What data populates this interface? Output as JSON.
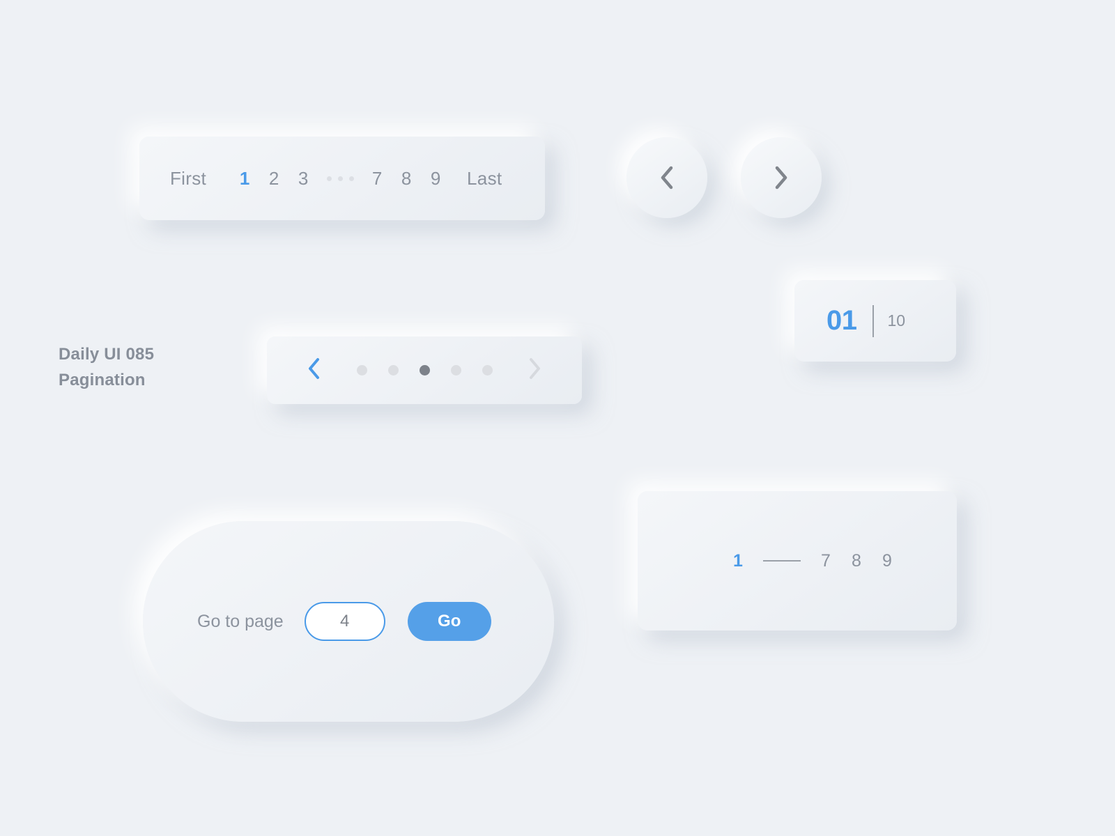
{
  "title": {
    "line1": "Daily UI 085",
    "line2": "Pagination"
  },
  "colors": {
    "background": "#eef1f5",
    "surface": "#f1f4f8",
    "accent_blue": "#4a9ae8",
    "button_blue": "#55a0e8",
    "text_gray": "#8c939e",
    "dot_inactive": "#dcdee2",
    "dot_active": "#7d828a"
  },
  "pagination_bar": {
    "first_label": "First",
    "last_label": "Last",
    "pages_left": [
      "1",
      "2",
      "3"
    ],
    "ellipsis": "...",
    "pages_right": [
      "7",
      "8",
      "9"
    ],
    "active_page": "1"
  },
  "circle_buttons": {
    "prev_icon": "chevron-left-icon",
    "next_icon": "chevron-right-icon"
  },
  "carousel": {
    "prev_icon": "chevron-left-icon",
    "next_icon": "chevron-right-icon",
    "dot_count": 5,
    "active_index": 2
  },
  "counter": {
    "current": "01",
    "total": "10",
    "divider": "|"
  },
  "goto": {
    "label": "Go to page",
    "value": "4",
    "placeholder": "4",
    "button_label": "Go"
  },
  "range": {
    "active_page": "1",
    "dash": "—",
    "pages": [
      "7",
      "8",
      "9"
    ]
  }
}
